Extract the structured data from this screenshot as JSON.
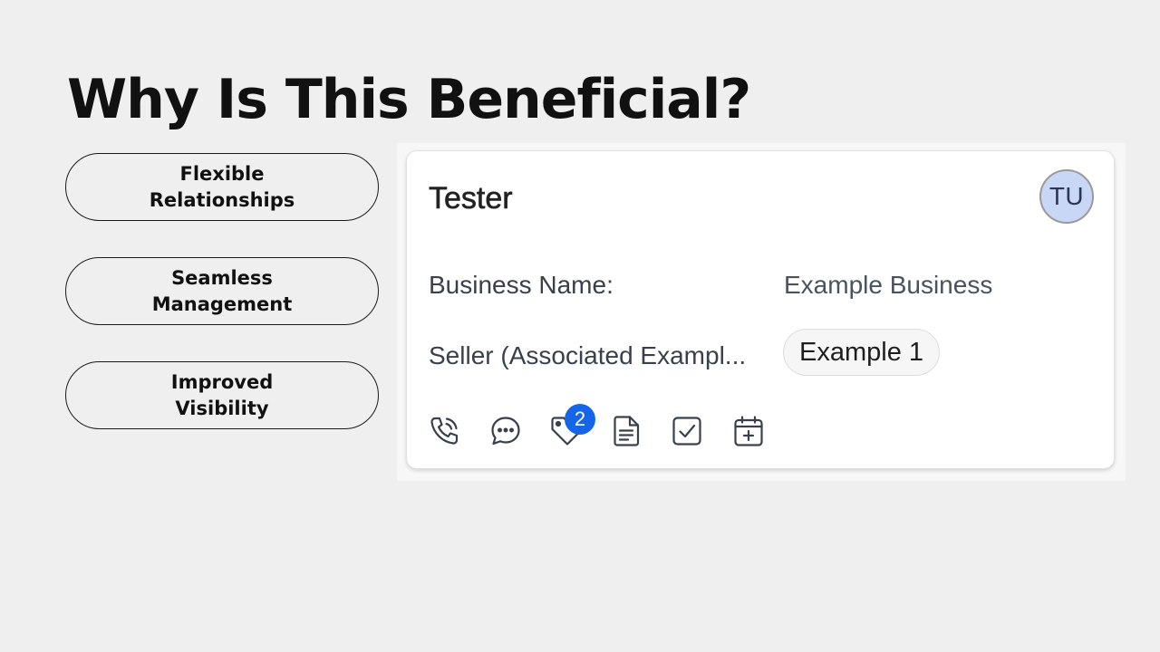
{
  "slide": {
    "title": "Why Is This Beneficial?"
  },
  "benefits": [
    {
      "line1": "Flexible",
      "line2": "Relationships"
    },
    {
      "line1": "Seamless",
      "line2": "Management"
    },
    {
      "line1": "Improved",
      "line2": "Visibility"
    }
  ],
  "card": {
    "title": "Tester",
    "avatar_initials": "TU",
    "fields": [
      {
        "label": "Business Name:",
        "value": "Example Business"
      },
      {
        "label": "Seller (Associated Exampl...",
        "value": "Example 1"
      }
    ],
    "actions": [
      {
        "icon": "phone-call-icon"
      },
      {
        "icon": "chat-bubble-icon"
      },
      {
        "icon": "tag-icon",
        "badge": "2"
      },
      {
        "icon": "document-icon"
      },
      {
        "icon": "checkbox-icon"
      },
      {
        "icon": "calendar-add-icon"
      }
    ]
  },
  "colors": {
    "background": "#efefef",
    "badge": "#1565e8",
    "avatar": "#c9d7f6"
  }
}
